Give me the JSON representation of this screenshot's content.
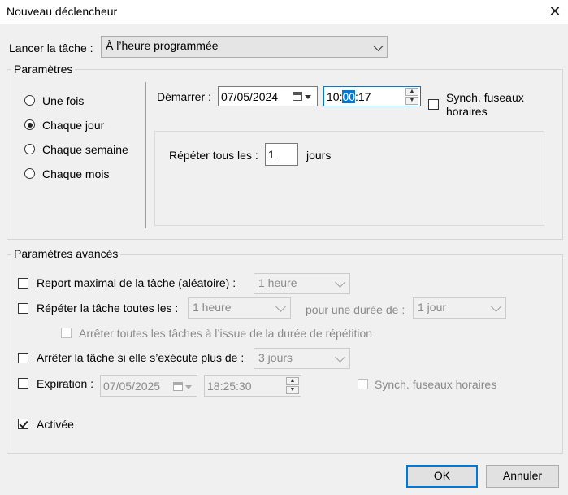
{
  "window": {
    "title": "Nouveau déclencheur"
  },
  "launch": {
    "label": "Lancer la tâche :",
    "value": "À l’heure programmée"
  },
  "settings": {
    "legend": "Paramètres",
    "frequency_options": [
      "Une fois",
      "Chaque jour",
      "Chaque semaine",
      "Chaque mois"
    ],
    "selected_frequency": "Chaque jour",
    "start_label": "Démarrer :",
    "start_date": "07/05/2024",
    "start_time_hours": "10:",
    "start_time_minutes": "00",
    "start_time_seconds": ":17",
    "sync_label": "Synch. fuseaux horaires",
    "sync_checked": false,
    "repeat_label": "Répéter tous les :",
    "repeat_value": "1",
    "repeat_unit": "jours"
  },
  "advanced": {
    "legend": "Paramètres avancés",
    "max_delay": {
      "label": "Report maximal de la tâche (aléatoire) :",
      "checked": false,
      "value": "1 heure"
    },
    "repeat_task": {
      "label": "Répéter la tâche toutes les :",
      "checked": false,
      "value": "1 heure",
      "duration_label": "pour une durée de :",
      "duration_value": "1 jour"
    },
    "stop_all": {
      "label": "Arrêter toutes les tâches à l’issue de la durée de répétition",
      "checked": false
    },
    "stop_if_longer": {
      "label": "Arrêter la tâche si elle s’exécute plus de :",
      "checked": false,
      "value": "3 jours"
    },
    "expiration": {
      "label": "Expiration :",
      "checked": false,
      "date": "07/05/2025",
      "time": "18:25:30",
      "sync_label": "Synch. fuseaux horaires",
      "sync_checked": false
    },
    "enabled": {
      "label": "Activée",
      "checked": true
    }
  },
  "buttons": {
    "ok": "OK",
    "cancel": "Annuler"
  },
  "colors": {
    "accent": "#0078d7",
    "background": "#f0f0f0"
  },
  "icons": {
    "close": "close-icon",
    "calendar": "calendar-icon",
    "dropdown": "chevron-down-icon"
  }
}
